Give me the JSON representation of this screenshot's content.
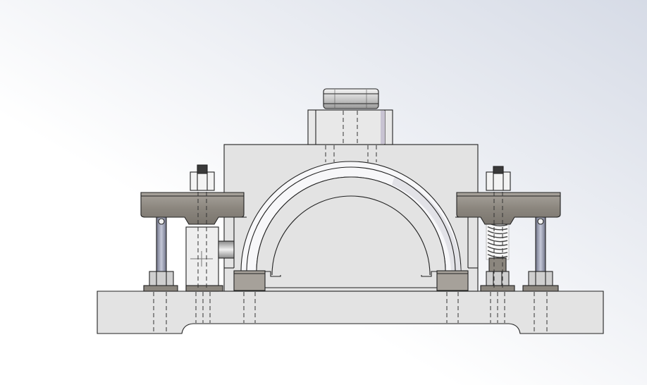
{
  "view": {
    "kind": "cad-front-view",
    "background": {
      "top_right": "#d6dbe6",
      "bottom_left": "#ffffff"
    },
    "palette": {
      "body": "#e3e3e3",
      "body_light": "#eeeeee",
      "edge": "#222222",
      "clamp_dark": "#8b867e",
      "clamp_mid": "#a6a19a",
      "bearing_white": "#f7f7f9",
      "bearing_shade": "#d0cfd8",
      "rod": "#9fa3b8",
      "nut": "#cfcfcf",
      "spring": "#f2f2f2"
    }
  },
  "parts": [
    {
      "id": "base-plate",
      "label": ""
    },
    {
      "id": "bearing-block",
      "label": ""
    },
    {
      "id": "half-bearing-shell",
      "label": ""
    },
    {
      "id": "top-boss",
      "label": ""
    },
    {
      "id": "top-cap-nut",
      "label": ""
    },
    {
      "id": "clamp-arm-left",
      "label": ""
    },
    {
      "id": "clamp-arm-right",
      "label": ""
    },
    {
      "id": "support-rod-left",
      "label": ""
    },
    {
      "id": "support-rod-right",
      "label": ""
    },
    {
      "id": "compression-spring",
      "label": ""
    },
    {
      "id": "locating-pin",
      "label": ""
    },
    {
      "id": "bearing-feet",
      "label": ""
    }
  ]
}
